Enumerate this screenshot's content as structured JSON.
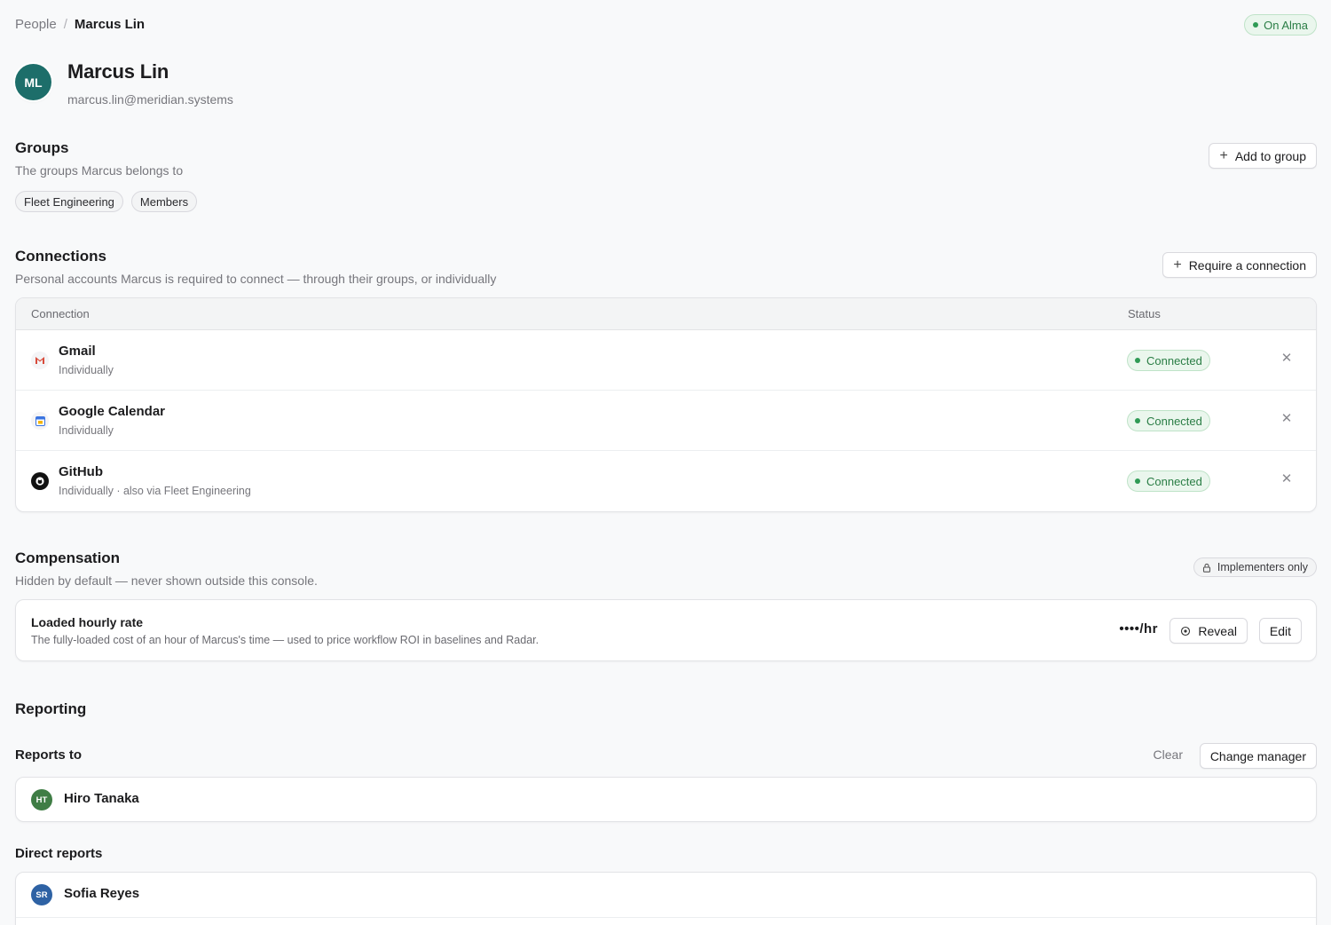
{
  "breadcrumb": {
    "parent": "People",
    "separator": "/",
    "current": "Marcus Lin"
  },
  "status": {
    "label": "On Alma",
    "color": "#2f9a55"
  },
  "profile": {
    "initials": "ML",
    "name": "Marcus Lin",
    "email": "marcus.lin@meridian.systems",
    "avatar_color": "#1d6e6a"
  },
  "groups": {
    "title": "Groups",
    "subtitle": "The groups Marcus belongs to",
    "add_label": "Add to group",
    "chips": [
      "Fleet Engineering",
      "Members"
    ]
  },
  "connections": {
    "title": "Connections",
    "subtitle": "Personal accounts Marcus is required to connect — through their groups, or individually",
    "require_label": "Require a connection",
    "columns": {
      "connection": "Connection",
      "status": "Status"
    },
    "rows": [
      {
        "icon": "gmail-icon",
        "name": "Gmail",
        "detail": "Individually",
        "status": "Connected"
      },
      {
        "icon": "google-calendar-icon",
        "name": "Google Calendar",
        "detail": "Individually",
        "status": "Connected"
      },
      {
        "icon": "github-icon",
        "name": "GitHub",
        "detail": "Individually · also via Fleet Engineering",
        "status": "Connected"
      }
    ]
  },
  "compensation": {
    "title": "Compensation",
    "subtitle": "Hidden by default — never shown outside this console.",
    "visibility": "Implementers only",
    "rate_title": "Loaded hourly rate",
    "rate_desc": "The fully-loaded cost of an hour of Marcus's time — used to price workflow ROI in baselines and Radar.",
    "rate_value": "••••/hr",
    "reveal_label": "Reveal",
    "edit_label": "Edit"
  },
  "reporting": {
    "title": "Reporting",
    "reports_to_label": "Reports to",
    "clear_label": "Clear",
    "change_label": "Change manager",
    "manager": {
      "initials": "HT",
      "name": "Hiro Tanaka",
      "color": "#3f7d45"
    },
    "direct_reports_label": "Direct reports",
    "direct_reports": [
      {
        "initials": "SR",
        "name": "Sofia Reyes",
        "color": "#2e62a4"
      }
    ]
  }
}
